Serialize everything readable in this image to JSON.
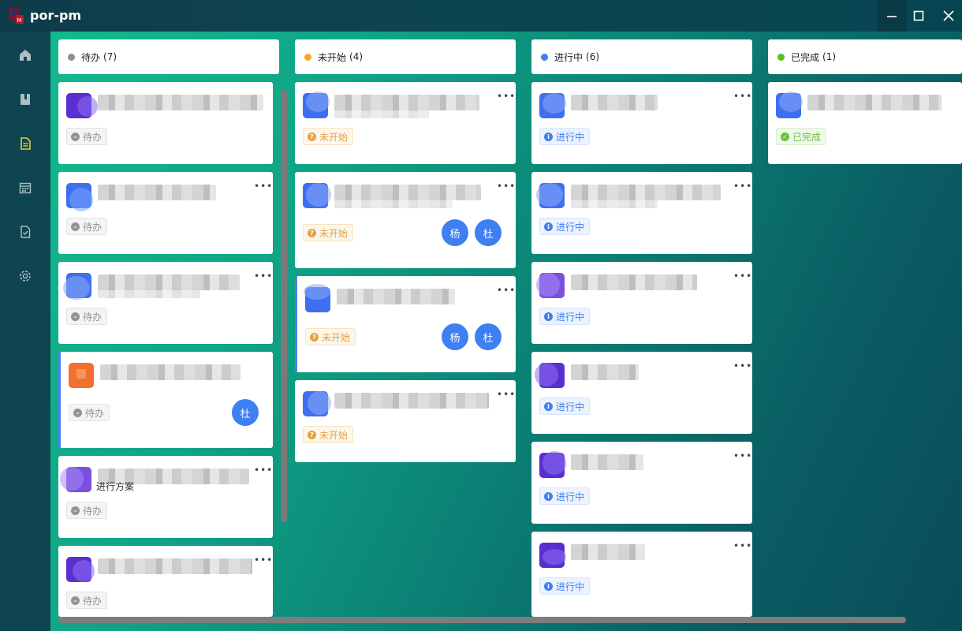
{
  "app": {
    "title": "por-pm"
  },
  "window": {
    "minimize": "minimize",
    "maximize": "maximize",
    "close": "close"
  },
  "sidebar": {
    "items": [
      {
        "name": "home",
        "icon": "home-icon"
      },
      {
        "name": "projects",
        "icon": "bookmark-icon"
      },
      {
        "name": "tasks",
        "icon": "document-icon",
        "active": true
      },
      {
        "name": "calendar",
        "icon": "calendar-icon"
      },
      {
        "name": "checklist",
        "icon": "check-file-icon"
      },
      {
        "name": "settings",
        "icon": "gear-icon"
      }
    ],
    "accent": "#e6c84a"
  },
  "columns": [
    {
      "title": "待办",
      "count": "(7)",
      "dot_color": "#8e8e93"
    },
    {
      "title": "未开始",
      "count": "(4)",
      "dot_color": "#f5a623"
    },
    {
      "title": "进行中",
      "count": "(6)",
      "dot_color": "#3f7ff0"
    },
    {
      "title": "已完成",
      "count": "(1)",
      "dot_color": "#52c41a"
    }
  ],
  "status_labels": {
    "todo": "待办",
    "notstart": "未开始",
    "doing": "进行中",
    "done": "已完成"
  },
  "cards": {
    "todo_extra_text": "进行方案",
    "avatars": {
      "yang": "杨",
      "du": "杜"
    }
  },
  "more_glyph": "•••"
}
